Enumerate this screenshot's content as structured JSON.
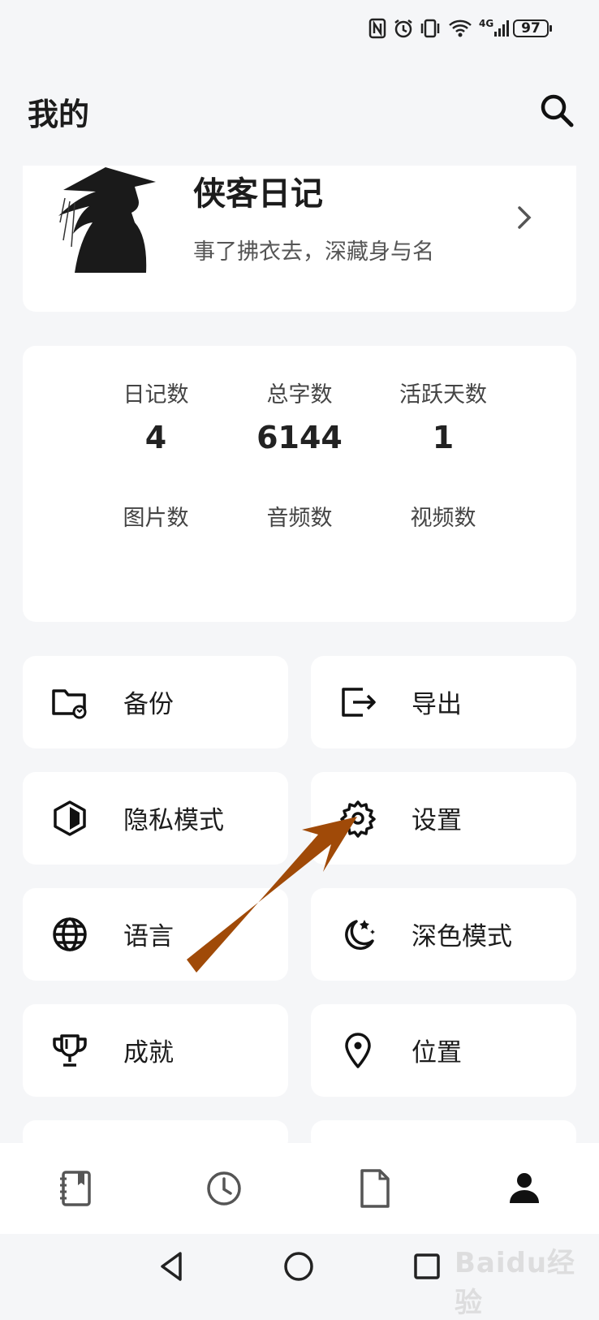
{
  "status_bar": {
    "battery": "97",
    "network": "4G"
  },
  "header": {
    "title": "我的"
  },
  "profile": {
    "name": "侠客日记",
    "motto": "事了拂衣去，深藏身与名"
  },
  "stats": [
    {
      "label": "日记数",
      "value": "4"
    },
    {
      "label": "总字数",
      "value": "6144"
    },
    {
      "label": "活跃天数",
      "value": "1"
    },
    {
      "label": "图片数",
      "value": ""
    },
    {
      "label": "音频数",
      "value": ""
    },
    {
      "label": "视频数",
      "value": ""
    }
  ],
  "menu": [
    {
      "label": "备份",
      "icon": "folder-sync-icon"
    },
    {
      "label": "导出",
      "icon": "export-icon"
    },
    {
      "label": "隐私模式",
      "icon": "privacy-shield-icon"
    },
    {
      "label": "设置",
      "icon": "gear-icon"
    },
    {
      "label": "语言",
      "icon": "globe-icon"
    },
    {
      "label": "深色模式",
      "icon": "moon-star-icon"
    },
    {
      "label": "成就",
      "icon": "trophy-icon"
    },
    {
      "label": "位置",
      "icon": "location-pin-icon"
    }
  ],
  "bottom_nav": [
    {
      "icon": "diary-book-icon"
    },
    {
      "icon": "clock-icon"
    },
    {
      "icon": "document-icon"
    },
    {
      "icon": "person-icon",
      "active": true
    }
  ],
  "watermark": "Baidu经验",
  "colors": {
    "accent_arrow": "#a04a08",
    "background": "#f5f6f8",
    "card": "#ffffff"
  }
}
